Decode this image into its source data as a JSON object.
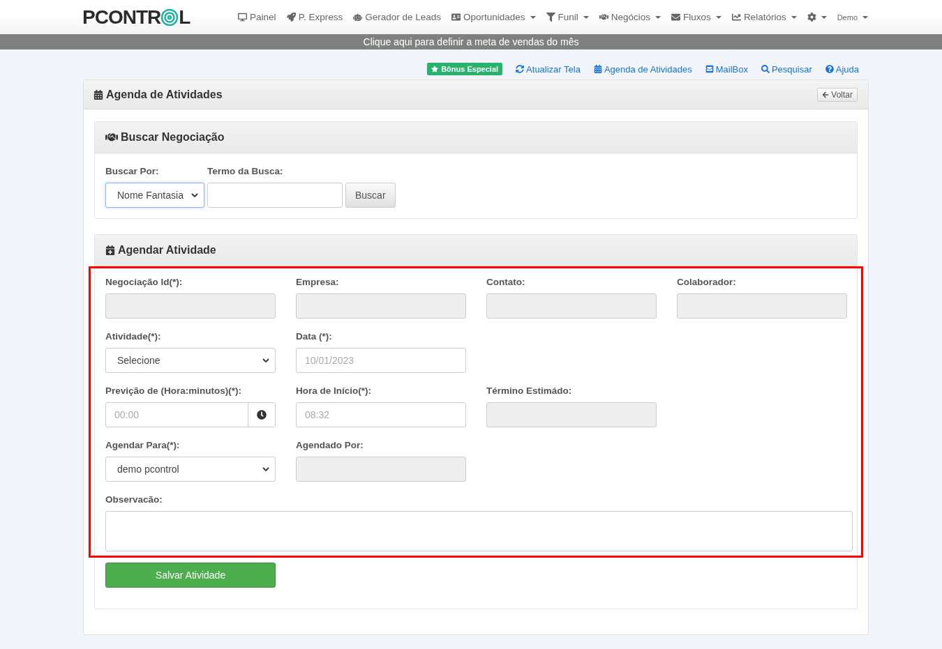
{
  "logo": {
    "before": "PCONTR",
    "after": "L"
  },
  "nav": [
    {
      "label": "Painel",
      "dropdown": false
    },
    {
      "label": "P. Express",
      "dropdown": false
    },
    {
      "label": "Gerador de Leads",
      "dropdown": false
    },
    {
      "label": "Oportunidades",
      "dropdown": true
    },
    {
      "label": "Funil",
      "dropdown": true
    },
    {
      "label": "Negócios",
      "dropdown": true
    },
    {
      "label": "Fluxos",
      "dropdown": true
    },
    {
      "label": "Relatórios",
      "dropdown": true
    },
    {
      "dropdown": true
    },
    {
      "label": "Demo",
      "dropdown": true
    }
  ],
  "banner": "Clique aqui para definir a meta de vendas do mês",
  "bonus": "Bônus Especial",
  "quick_links": [
    "Atualizar Tela",
    "Agenda de Atividades",
    "MailBox",
    "Pesquisar",
    "Ajuda"
  ],
  "panel": {
    "title": "Agenda de Atividades",
    "back": "Voltar"
  },
  "search": {
    "title": "Buscar Negociação",
    "by_label": "Buscar Por:",
    "by_value": "Nome Fantasia",
    "term_label": "Termo da Busca:",
    "button": "Buscar"
  },
  "schedule": {
    "title": "Agendar Atividade",
    "highlighted": true,
    "rows": [
      [
        {
          "kind": "text",
          "label": "Negociação Id(*):",
          "disabled": true
        },
        {
          "kind": "text",
          "label": "Empresa:",
          "disabled": true
        },
        {
          "kind": "text",
          "label": "Contato:",
          "disabled": true
        },
        {
          "kind": "text",
          "label": "Colaborador:",
          "disabled": true
        }
      ],
      [
        {
          "kind": "select",
          "label": "Atividade(*):",
          "value": "Selecione"
        },
        {
          "kind": "text",
          "label": "Data (*):",
          "placeholder": "10/01/2023",
          "disabled": false
        }
      ],
      [
        {
          "kind": "time",
          "label": "Previção de (Hora:minutos)(*):",
          "placeholder": "00:00"
        },
        {
          "kind": "text",
          "label": "Hora de Início(*):",
          "placeholder": "08:32",
          "disabled": false
        },
        {
          "kind": "text",
          "label": "Término Estimádo:",
          "disabled": true
        }
      ],
      [
        {
          "kind": "select",
          "label": "Agendar Para(*):",
          "value": "demo pcontrol"
        },
        {
          "kind": "text",
          "label": "Agendado Por:",
          "disabled": true
        }
      ]
    ],
    "note_label": "Observacão:",
    "save": "Salvar Atividade"
  }
}
